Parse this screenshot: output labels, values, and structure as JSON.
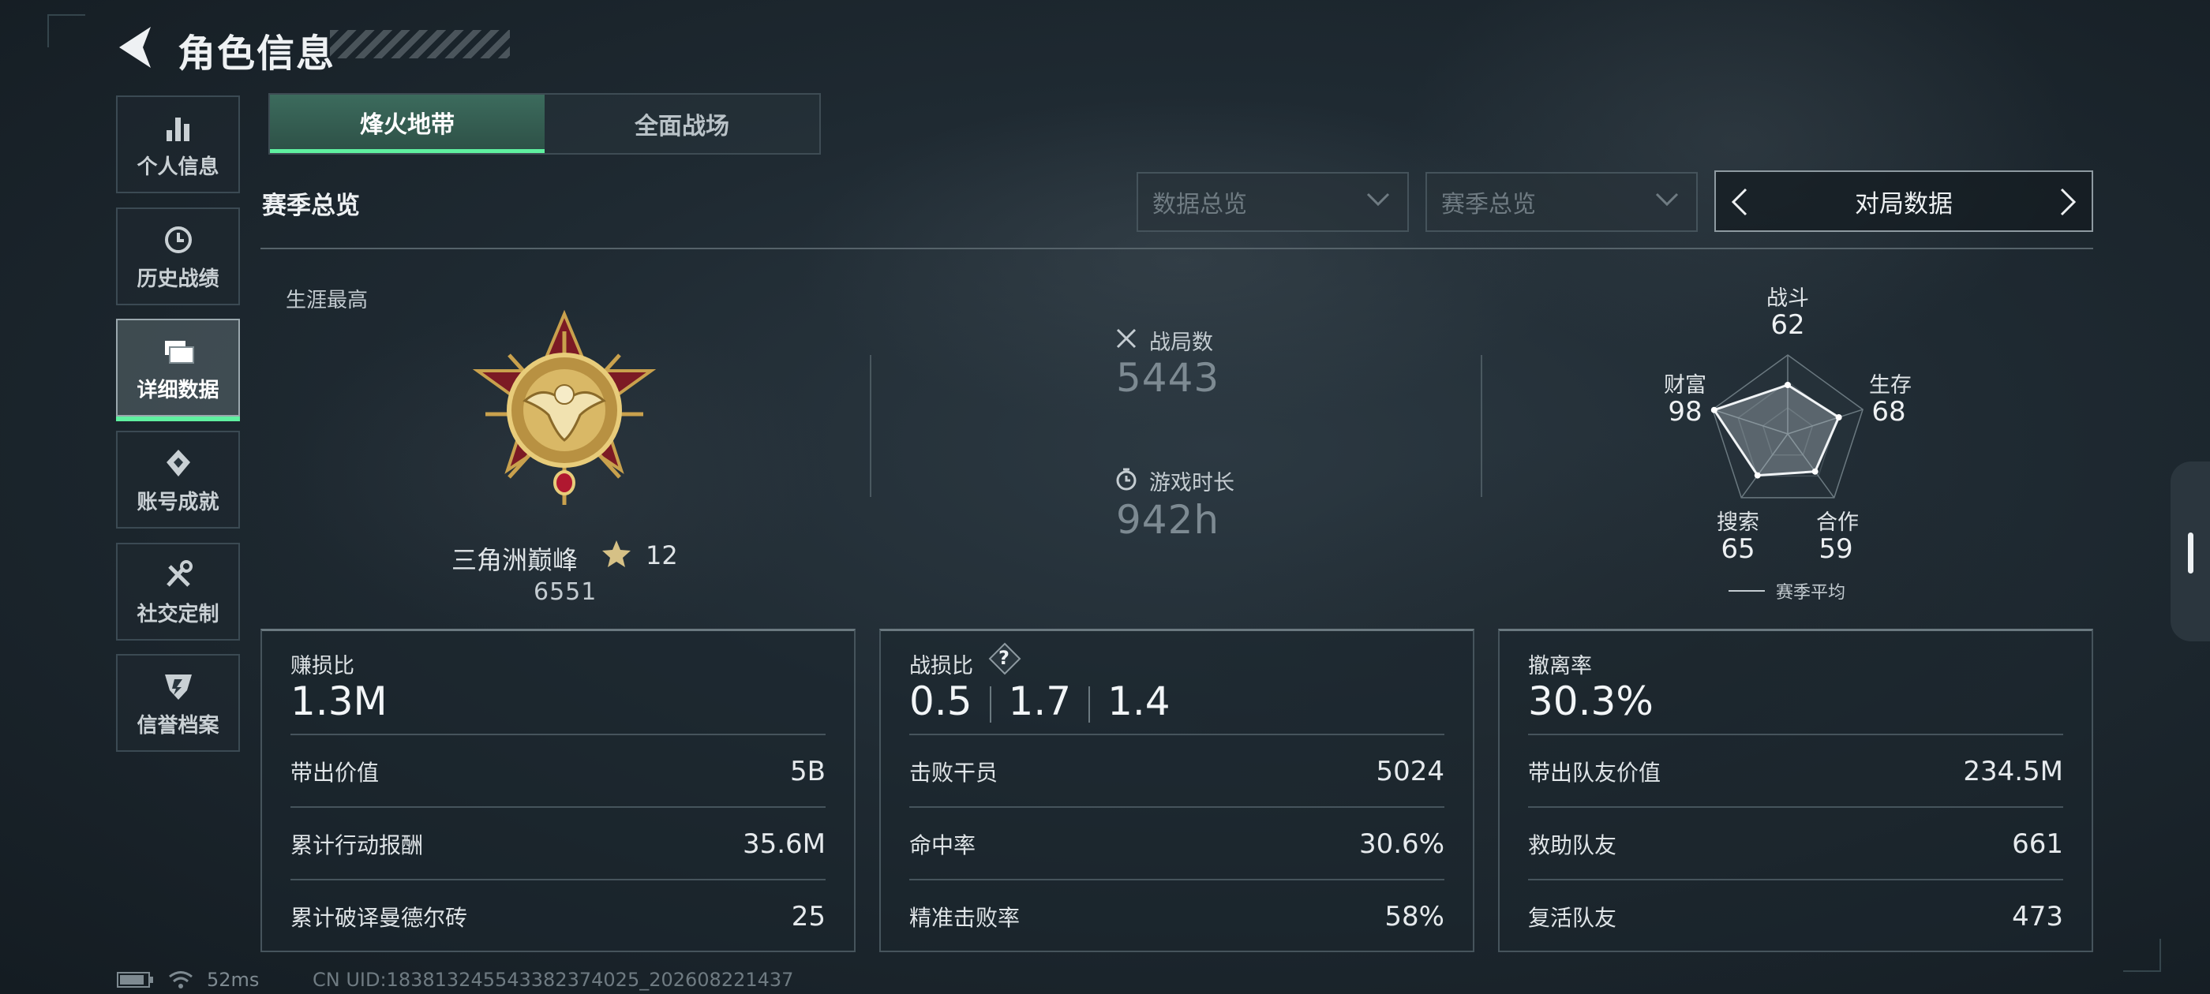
{
  "header": {
    "title": "角色信息"
  },
  "sidebar": {
    "items": [
      {
        "label": "个人信息",
        "icon": "bar-chart-icon"
      },
      {
        "label": "历史战绩",
        "icon": "clock-icon"
      },
      {
        "label": "详细数据",
        "icon": "folder-icon",
        "active": true
      },
      {
        "label": "账号成就",
        "icon": "badge-icon"
      },
      {
        "label": "社交定制",
        "icon": "tools-icon"
      },
      {
        "label": "信誉档案",
        "icon": "emblem-icon"
      }
    ]
  },
  "tabs": [
    {
      "label": "烽火地带",
      "active": true
    },
    {
      "label": "全面战场",
      "active": false
    }
  ],
  "section": {
    "title": "赛季总览"
  },
  "filters": {
    "data_select": "数据总览",
    "season_select": "赛季总览",
    "pager_label": "对局数据"
  },
  "career": {
    "label": "生涯最高",
    "rank_name": "三角洲巅峰",
    "stars": "12",
    "score": "6551"
  },
  "stats": {
    "matches_label": "战局数",
    "matches_value": "5443",
    "playtime_label": "游戏时长",
    "playtime_value": "942h"
  },
  "radar": {
    "legend": "赛季平均",
    "axes": [
      {
        "label": "战斗",
        "value": "62",
        "score": 62
      },
      {
        "label": "生存",
        "value": "68",
        "score": 68
      },
      {
        "label": "合作",
        "value": "59",
        "score": 59
      },
      {
        "label": "搜索",
        "value": "65",
        "score": 65
      },
      {
        "label": "财富",
        "value": "98",
        "score": 98
      }
    ]
  },
  "panels": {
    "profit": {
      "title": "赚损比",
      "big": "1.3M",
      "rows": [
        {
          "k": "带出价值",
          "v": "5B"
        },
        {
          "k": "累计行动报酬",
          "v": "35.6M"
        },
        {
          "k": "累计破译曼德尔砖",
          "v": "25"
        }
      ]
    },
    "kd": {
      "title": "战损比",
      "help": "?",
      "ratios": [
        "0.5",
        "1.7",
        "1.4"
      ],
      "rows": [
        {
          "k": "击败干员",
          "v": "5024"
        },
        {
          "k": "命中率",
          "v": "30.6%"
        },
        {
          "k": "精准击败率",
          "v": "58%"
        }
      ]
    },
    "extract": {
      "title": "撤离率",
      "big": "30.3%",
      "rows": [
        {
          "k": "带出队友价值",
          "v": "234.5M"
        },
        {
          "k": "救助队友",
          "v": "661"
        },
        {
          "k": "复活队友",
          "v": "473"
        }
      ]
    }
  },
  "footer": {
    "ping": "52ms",
    "uid": "CN UID:183813245543382374025_202608221437"
  }
}
